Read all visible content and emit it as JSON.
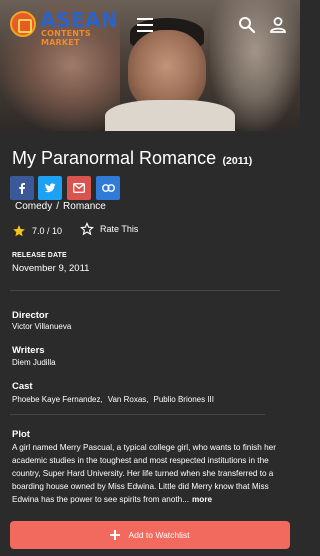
{
  "header": {
    "logo_word": "ASEAN",
    "logo_sub": "CONTENTS MARKET"
  },
  "movie": {
    "title": "My Paranormal Romance",
    "year": "(2011)",
    "genres": [
      "Comedy",
      "Romance"
    ],
    "genre_separator": "/",
    "rating": "7.0 / 10",
    "rate_label": "Rate This"
  },
  "details": {
    "release_label": "RELEASE DATE",
    "release_date": "November 9, 2011",
    "director_label": "Director",
    "director": "Victor Villanueva",
    "writers_label": "Writers",
    "writers": "Diem Judilla",
    "cast_label": "Cast",
    "cast": [
      "Phoebe Kaye Fernandez,",
      "Van Roxas,",
      "Publio Briones III"
    ],
    "plot_label": "Plot",
    "plot": "A girl named Merry Pascual, a typical college girl, who wants to finish her academic studies in the toughest and most respected institutions in the country, Super Hard University. Her life turned when she transferred to a boarding house owned by Miss Edwina. Little did Merry know that Miss Edwina has the power to see spirits from anoth...",
    "more_label": "more"
  },
  "actions": {
    "watchlist_label": "Add to Watchlist"
  },
  "colors": {
    "background": "#2b2b2b",
    "accent": "#f26a5e",
    "star": "#f5c518",
    "facebook": "#3b5998",
    "twitter": "#1da1f2",
    "mail": "#d9534f",
    "link": "#2f7bd6"
  },
  "icons": {
    "menu": "hamburger-icon",
    "search": "search-icon",
    "account": "person-icon",
    "star": "star-icon",
    "rate": "star-outline-icon",
    "add": "plus-icon"
  }
}
